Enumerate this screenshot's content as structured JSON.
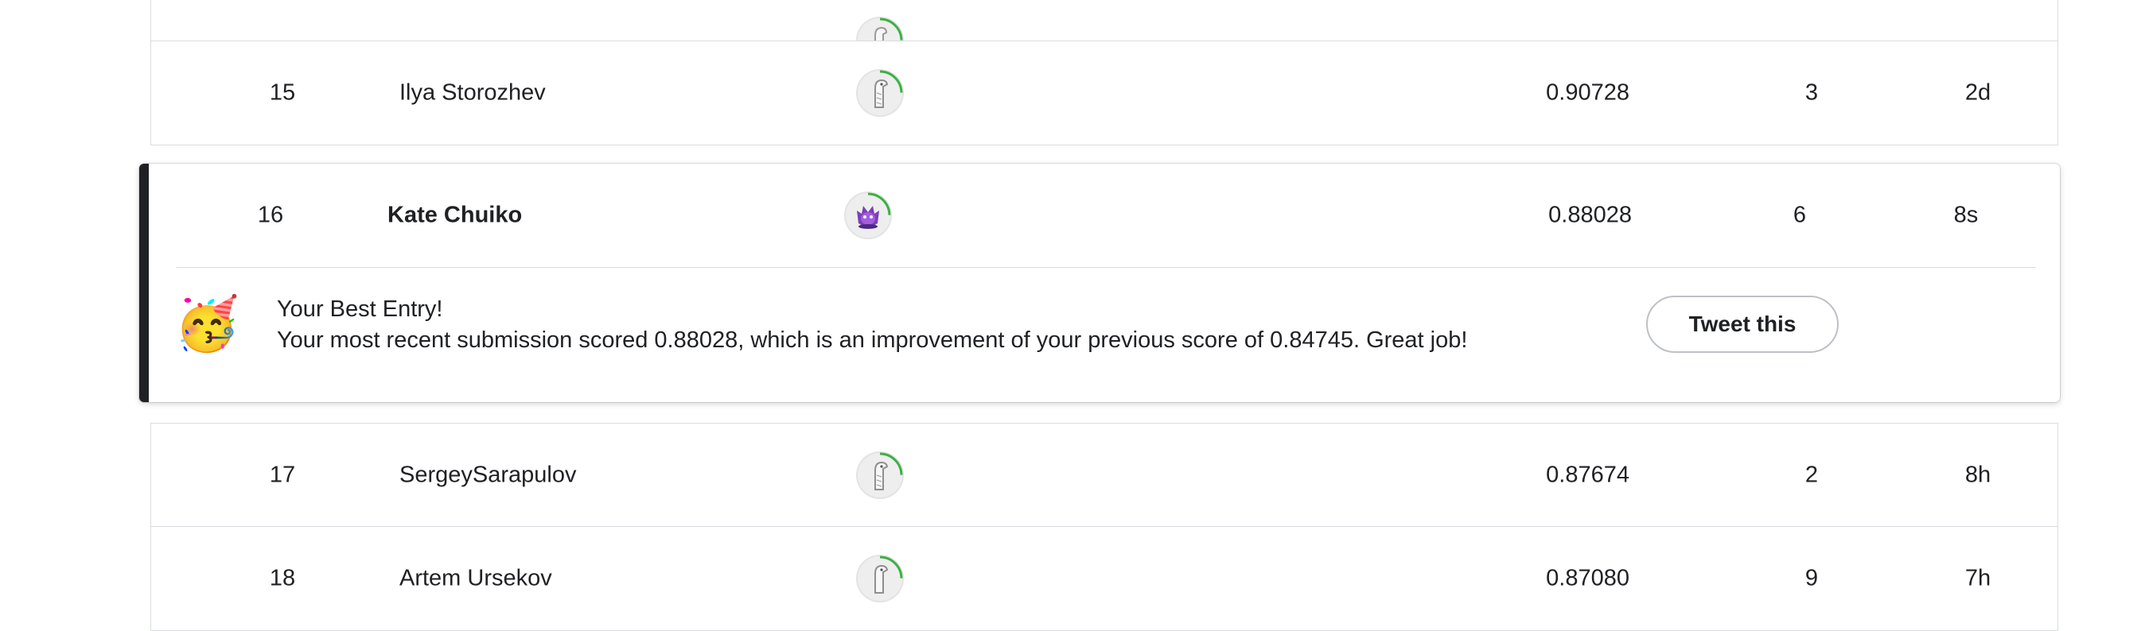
{
  "rows": [
    {
      "rank": "15",
      "name": "Ilya Storozhev",
      "score": "0.90728",
      "entries": "3",
      "last": "2d",
      "avatar_icon": "ostrich-avatar-icon",
      "progress": 0.25
    },
    {
      "rank": "16",
      "name": "Kate Chuiko",
      "score": "0.88028",
      "entries": "6",
      "last": "8s",
      "avatar_icon": "purple-creature-avatar-icon",
      "progress": 0.25
    },
    {
      "rank": "17",
      "name": "SergeySarapulov",
      "score": "0.87674",
      "entries": "2",
      "last": "8h",
      "avatar_icon": "ostrich-avatar-icon",
      "progress": 0.25
    },
    {
      "rank": "18",
      "name": "Artem Ursekov",
      "score": "0.87080",
      "entries": "9",
      "last": "7h",
      "avatar_icon": "ostrich-avatar-icon",
      "progress": 0.25
    }
  ],
  "best_entry": {
    "emoji": "🥳",
    "title": "Your Best Entry!",
    "message": "Your most recent submission scored 0.88028, which is an improvement of your previous score of 0.84745. Great job!",
    "tweet_label": "Tweet this"
  },
  "colors": {
    "progress_ring": "#3cb043",
    "highlight_bar": "#202124",
    "border": "#dadce0"
  }
}
